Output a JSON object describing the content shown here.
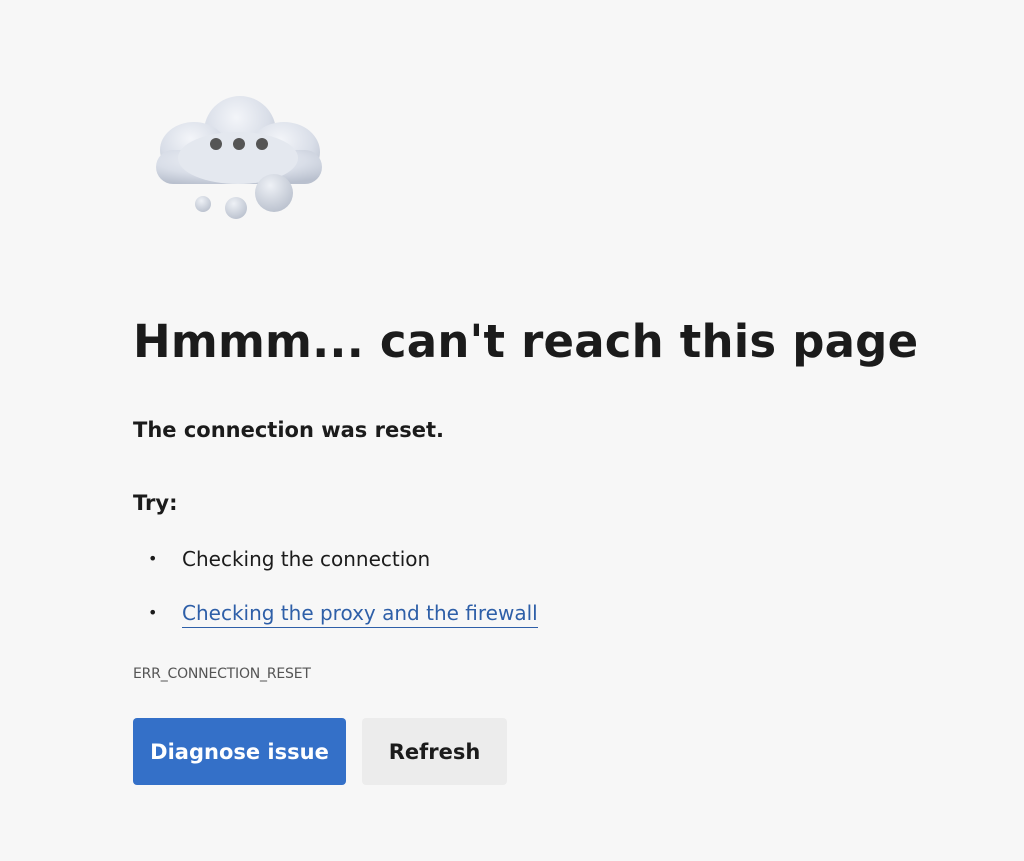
{
  "illustration": {
    "icon": "cloud-thinking-icon"
  },
  "error": {
    "title": "Hmmm... can't reach this page",
    "message": "The connection was reset.",
    "try_heading": "Try:",
    "suggestions": [
      {
        "text": "Checking the connection",
        "is_link": false
      },
      {
        "text": "Checking the proxy and the firewall",
        "is_link": true
      }
    ],
    "code": "ERR_CONNECTION_RESET"
  },
  "buttons": {
    "diagnose_label": "Diagnose issue",
    "refresh_label": "Refresh"
  },
  "colors": {
    "background": "#f7f7f7",
    "primary_button": "#3470c8",
    "secondary_button": "#ececec",
    "link": "#2e5fa8"
  }
}
